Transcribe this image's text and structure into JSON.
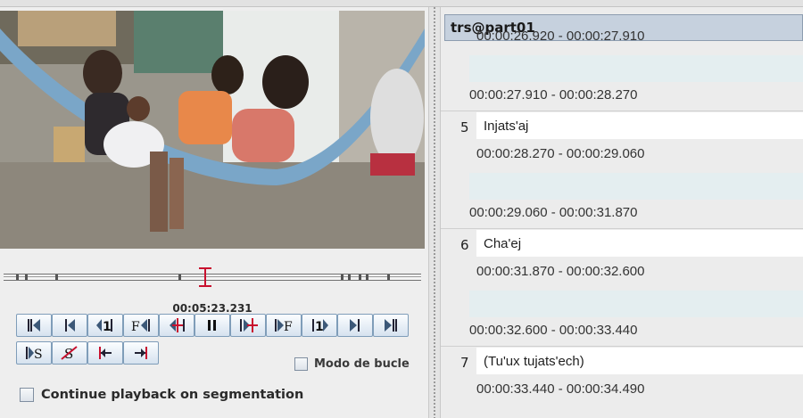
{
  "player": {
    "timecode": "00:05:23.231",
    "buttons": [
      {
        "name": "go-to-begin-button",
        "icon": "go-to-begin-icon"
      },
      {
        "name": "previous-frame-button",
        "icon": "previous-frame-icon"
      },
      {
        "name": "previous-second-button",
        "icon": "previous-second-icon"
      },
      {
        "name": "previous-pixel-button",
        "icon": "previous-pixel-icon"
      },
      {
        "name": "play-backward-button",
        "icon": "play-backward-icon"
      },
      {
        "name": "pause-button",
        "icon": "pause-icon"
      },
      {
        "name": "play-forward-button",
        "icon": "play-forward-icon"
      },
      {
        "name": "next-pixel-button",
        "icon": "next-pixel-icon"
      },
      {
        "name": "next-second-button",
        "icon": "next-second-icon"
      },
      {
        "name": "next-frame-button",
        "icon": "next-frame-icon"
      },
      {
        "name": "go-to-end-button",
        "icon": "go-to-end-icon"
      },
      {
        "name": "play-selection-button",
        "icon": "play-selection-icon"
      },
      {
        "name": "clear-selection-button",
        "icon": "clear-selection-icon"
      },
      {
        "name": "selection-begin-button",
        "icon": "selection-begin-icon"
      },
      {
        "name": "selection-end-button",
        "icon": "selection-end-icon"
      }
    ],
    "loop_mode_label": "Modo de bucle",
    "continue_playback_label": "Continue playback on segmentation"
  },
  "transcript": {
    "tier_name": "trs@part01",
    "entries": [
      {
        "kind": "time",
        "text": "00:00:26.920 - 00:00:27.910"
      },
      {
        "kind": "gap"
      },
      {
        "kind": "time",
        "text": "00:00:27.910 - 00:00:28.270"
      },
      {
        "kind": "annotation",
        "number": "5",
        "text": "Injats'aj"
      },
      {
        "kind": "time",
        "text": "00:00:28.270 - 00:00:29.060"
      },
      {
        "kind": "gap"
      },
      {
        "kind": "time",
        "text": "00:00:29.060 - 00:00:31.870"
      },
      {
        "kind": "annotation",
        "number": "6",
        "text": "Cha'ej"
      },
      {
        "kind": "time",
        "text": "00:00:31.870 - 00:00:32.600"
      },
      {
        "kind": "gap"
      },
      {
        "kind": "time",
        "text": "00:00:32.600 - 00:00:33.440"
      },
      {
        "kind": "annotation",
        "number": "7",
        "text": "(Tu'ux tujats'ech)"
      },
      {
        "kind": "time",
        "text": "00:00:33.440 - 00:00:34.490"
      }
    ]
  }
}
